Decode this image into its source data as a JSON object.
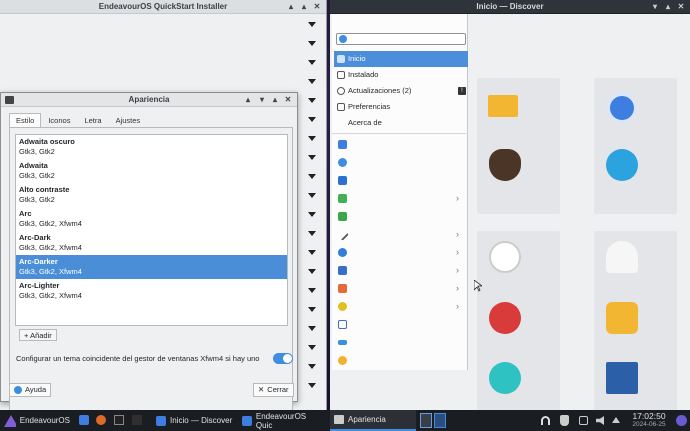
{
  "installer": {
    "title": "EndeavourOS QuickStart Installer"
  },
  "apariencia": {
    "title": "Apariencia",
    "tabs": [
      "Estilo",
      "Iconos",
      "Letra",
      "Ajustes"
    ],
    "themes": [
      {
        "name": "Adwaita oscuro",
        "sub": "Gtk3, Gtk2"
      },
      {
        "name": "Adwaita",
        "sub": "Gtk3, Gtk2"
      },
      {
        "name": "Alto contraste",
        "sub": "Gtk3, Gtk2"
      },
      {
        "name": "Arc",
        "sub": "Gtk3, Gtk2, Xfwm4"
      },
      {
        "name": "Arc-Dark",
        "sub": "Gtk3, Gtk2, Xfwm4"
      },
      {
        "name": "Arc-Darker",
        "sub": "Gtk3, Gtk2, Xfwm4"
      },
      {
        "name": "Arc-Lighter",
        "sub": "Gtk3, Gtk2, Xfwm4"
      }
    ],
    "add_label": "Añadir",
    "config_text": "Configurar un tema coincidente del gestor de ventanas Xfwm4 si hay uno",
    "help_label": "Ayuda",
    "close_label": "Cerrar"
  },
  "discover": {
    "title": "Inicio — Discover",
    "nav": [
      {
        "label": "Inicio"
      },
      {
        "label": "Instalado"
      },
      {
        "label": "Actualizaciones (2)"
      },
      {
        "label": "Preferencias"
      },
      {
        "label": "Acerca de"
      }
    ],
    "category_colors": [
      "#3d7ee0",
      "#3d8ee0",
      "#2f6fd0",
      "#3fb34f",
      "#3aa84a",
      "#555555",
      "#2f7ed8",
      "#3b6ec9",
      "#e56a3a",
      "#e0c020",
      "#3b6ec9",
      "#3b8ee0",
      "#f0b030"
    ]
  },
  "taskbar": {
    "start_label": "EndeavourOS",
    "task_discover": "Inicio — Discover",
    "task_installer": "EndeavourOS Quic",
    "task_apariencia": "Apariencia",
    "time": "17:02:50",
    "date": "2024-06-25"
  }
}
